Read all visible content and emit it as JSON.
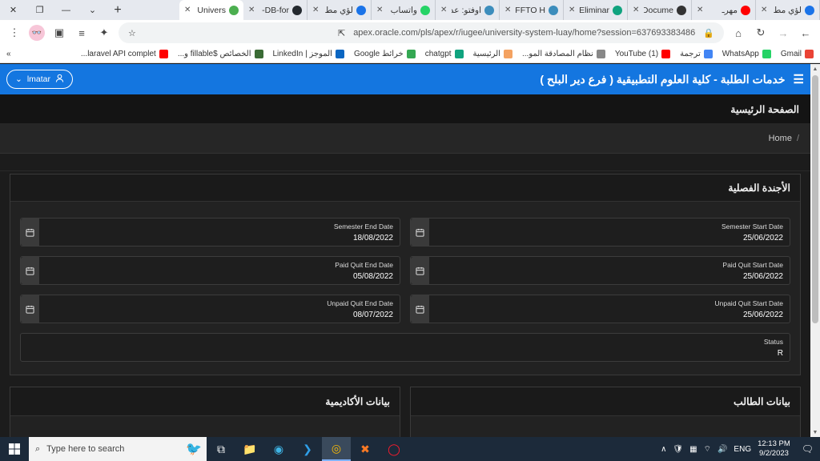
{
  "browser": {
    "tabs": [
      {
        "title": "لؤي مط",
        "icon_color": "#1a73e8"
      },
      {
        "title": "مهرـ",
        "icon_color": "#ff0000"
      },
      {
        "title": "Docume",
        "icon_color": "#333333"
      },
      {
        "title": "Eliminar",
        "icon_color": "#10a37f"
      },
      {
        "title": "OFFTO H",
        "icon_color": "#3c8dbc"
      },
      {
        "title": "اوفتو: عد",
        "icon_color": "#3c8dbc"
      },
      {
        "title": "واتساب",
        "icon_color": "#25d366"
      },
      {
        "title": "لؤي مط",
        "icon_color": "#1a73e8"
      },
      {
        "title": "DB-for-",
        "icon_color": "#24292f"
      },
      {
        "title": "Univers",
        "icon_color": "#4caf50",
        "active": true
      }
    ],
    "url": "apex.oracle.com/pls/apex/r/iugee/university-system-luay/home?session=637693383486",
    "bookmarks": [
      {
        "label": "Gmail",
        "color": "#ea4335"
      },
      {
        "label": "WhatsApp",
        "color": "#25d366"
      },
      {
        "label": "ترجمة",
        "color": "#4285f4"
      },
      {
        "label": "YouTube (1)",
        "color": "#ff0000"
      },
      {
        "label": "نظام المصادقة المو...",
        "color": "#888888"
      },
      {
        "label": "الرئيسية",
        "color": "#f4a261"
      },
      {
        "label": "chatgpt",
        "color": "#10a37f"
      },
      {
        "label": "خرائط Google",
        "color": "#34a853"
      },
      {
        "label": "الموجز | LinkedIn",
        "color": "#0a66c2"
      },
      {
        "label": "الخصائص $fillable و...",
        "color": "#3a6b35"
      },
      {
        "label": "laravel API complet...",
        "color": "#ff0000"
      }
    ],
    "more_bookmarks": "«"
  },
  "app": {
    "title": "خدمات الطلبة - كلية العلوم التطبيقية ( فرع دير البلح )",
    "user": "lmatar",
    "page_title": "الصفحة الرئيسية",
    "breadcrumb": "Home",
    "breadcrumb_sep": "/"
  },
  "agenda": {
    "title": "الأجندة الفصلية",
    "fields": [
      {
        "label": "Semester Start Date",
        "value": "25/06/2022"
      },
      {
        "label": "Semester End Date",
        "value": "18/08/2022"
      },
      {
        "label": "Paid Quit Start Date",
        "value": "25/06/2022"
      },
      {
        "label": "Paid Quit End Date",
        "value": "05/08/2022"
      },
      {
        "label": "Unpaid Quit Start Date",
        "value": "25/06/2022"
      },
      {
        "label": "Unpaid Quit End Date",
        "value": "08/07/2022"
      }
    ],
    "status": {
      "label": "Status",
      "value": "R"
    }
  },
  "panels": {
    "student": "بيانات الطالب",
    "academic": "بيانات الأكاديمية"
  },
  "taskbar": {
    "search_placeholder": "Type here to search",
    "lang": "ENG",
    "time": "12:13 PM",
    "date": "9/2/2023"
  }
}
